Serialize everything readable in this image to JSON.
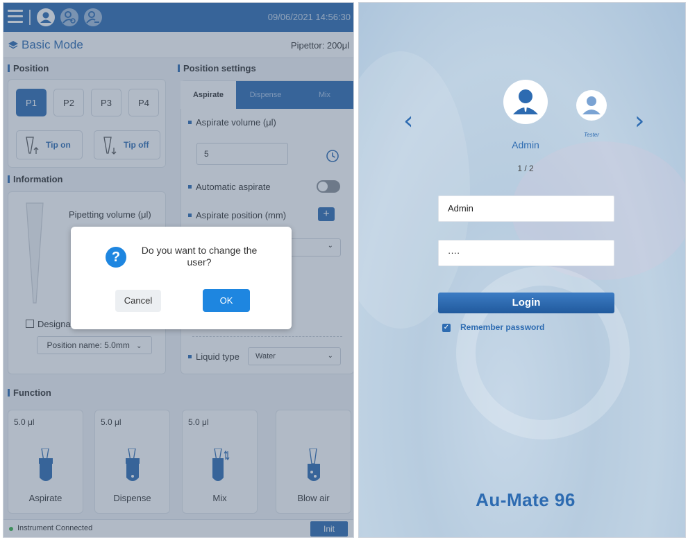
{
  "left": {
    "datetime": "09/06/2021 14:56:30",
    "mode_title": "Basic Mode",
    "pipettor": "Pipettor: 200μl",
    "position_title": "Position",
    "positions": [
      "P1",
      "P2",
      "P3",
      "P4"
    ],
    "active_position": "P1",
    "tip_on": "Tip on",
    "tip_off": "Tip off",
    "information_title": "Information",
    "pipetting_volume_label": "Pipetting volume (μl)",
    "designate_label": "Designa",
    "position_name_select": "Position name: 5.0mm",
    "position_settings_title": "Position settings",
    "tabs": [
      "Aspirate",
      "Dispense",
      "Mix"
    ],
    "aspirate_volume_label": "Aspirate volume (μl)",
    "aspirate_volume_value": "5",
    "automatic_aspirate_label": "Automatic aspirate",
    "aspirate_position_label": "Aspirate position (mm)",
    "liquid_type_label": "Liquid type",
    "liquid_type_value": "Water",
    "function_title": "Function",
    "functions": [
      {
        "volume": "5.0 μl",
        "name": "Aspirate"
      },
      {
        "volume": "5.0 μl",
        "name": "Dispense"
      },
      {
        "volume": "5.0 μl",
        "name": "Mix"
      },
      {
        "volume": "",
        "name": "Blow air"
      }
    ],
    "status_text": "Instrument Connected",
    "init_label": "Init",
    "dialog": {
      "message": "Do you want to change the user?",
      "cancel": "Cancel",
      "ok": "OK"
    },
    "colors": {
      "primary": "#2d6bb1",
      "dialog_button": "#1e86e0",
      "status_connected": "#3cb44a"
    }
  },
  "right": {
    "users": [
      "Admin",
      "Tester"
    ],
    "pager": "1 / 2",
    "username_value": "Admin",
    "password_value": "····",
    "login_label": "Login",
    "remember_label": "Remember password",
    "remember_checked": true,
    "brand": "Au-Mate 96"
  }
}
